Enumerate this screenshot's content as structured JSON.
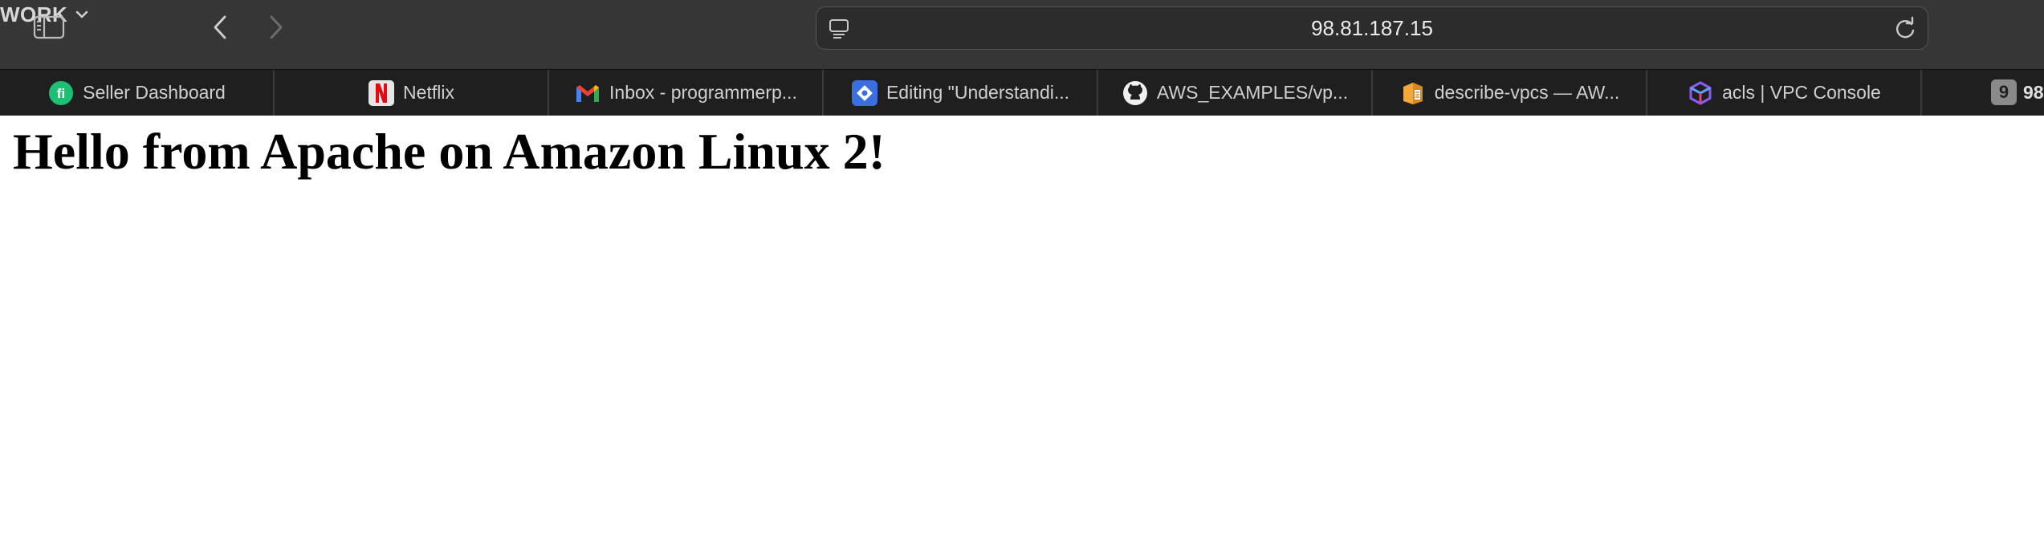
{
  "toolbar": {
    "group_label": "WORK",
    "address": "98.81.187.15"
  },
  "tabs": [
    {
      "title": "Seller Dashboard",
      "icon": "fiverr-icon"
    },
    {
      "title": "Netflix",
      "icon": "netflix-icon"
    },
    {
      "title": "Inbox - programmerp...",
      "icon": "gmail-icon"
    },
    {
      "title": "Editing \"Understandi...",
      "icon": "editor-icon"
    },
    {
      "title": "AWS_EXAMPLES/vp...",
      "icon": "github-icon"
    },
    {
      "title": "describe-vpcs — AW...",
      "icon": "aws-docs-icon"
    },
    {
      "title": "acls | VPC Console",
      "icon": "vpc-console-icon"
    }
  ],
  "tab_overflow": {
    "count": "9",
    "partial_text": "98"
  },
  "page": {
    "heading": "Hello from Apache on Amazon Linux 2!"
  },
  "colors": {
    "toolbar_bg": "#363636",
    "tabstrip_bg": "#1f1f1f",
    "fiverr_green": "#1dbf73",
    "netflix_red": "#e50914"
  }
}
